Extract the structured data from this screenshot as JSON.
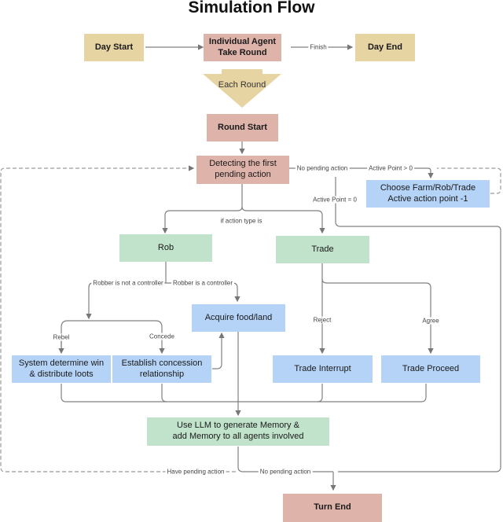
{
  "title": "Simulation Flow",
  "nodes": {
    "day_start": "Day Start",
    "individual_agent": "Individual Agent\nTake Round",
    "day_end": "Day End",
    "each_round": "Each Round",
    "round_start": "Round Start",
    "detecting": "Detecting the first\npending action",
    "choose": "Choose Farm/Rob/Trade\nActive action point -1",
    "rob": "Rob",
    "trade": "Trade",
    "acquire": "Acquire food/land",
    "system_determine": "System determine win\n& distribute loots",
    "establish": "Establish concession\nrelationship",
    "trade_interrupt": "Trade Interrupt",
    "trade_proceed": "Trade Proceed",
    "use_llm": "Use LLM to generate Memory &\nadd Memory to all agents involved",
    "turn_end": "Turn End"
  },
  "edge_labels": {
    "finish": "Finish",
    "no_pending_action_top": "No pending action",
    "active_point_gt0": "Active Point > 0",
    "active_point_eq0": "Active Point = 0",
    "if_action_type": "if action type is",
    "robber_not_controller": "Robber is not a controller",
    "robber_is_controller": "Robber is a controller",
    "rebel": "Rebel",
    "concede": "Concede",
    "reject": "Reject",
    "agree": "Agree",
    "have_pending_action": "Have pending action",
    "no_pending_action_bottom": "No pending action"
  },
  "colors": {
    "tan": "#e6d4a3",
    "rose": "#deb3aa",
    "green": "#c1e2cb",
    "blue": "#b5d3f6",
    "line": "#7a7a7a"
  }
}
